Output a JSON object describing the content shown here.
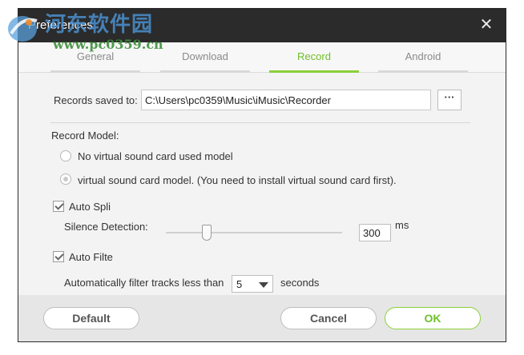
{
  "window": {
    "title": "Preferences",
    "close_glyph": "✕"
  },
  "tabs": [
    {
      "label": "General",
      "active": false
    },
    {
      "label": "Download",
      "active": false
    },
    {
      "label": "Record",
      "active": true
    },
    {
      "label": "Android",
      "active": false
    }
  ],
  "record": {
    "saved_to_label": "Records saved to:",
    "saved_to_value": "C:\\Users\\pc0359\\Music\\iMusic\\Recorder",
    "browse_label": "···",
    "model_label": "Record Model:",
    "model_options": [
      {
        "label": "No virtual sound card used model",
        "checked": false
      },
      {
        "label": "virtual sound card model. (You need to install virtual sound card first).",
        "checked": true
      }
    ],
    "auto_split": {
      "label": "Auto Spli",
      "checked": true
    },
    "silence_label": "Silence Detection:",
    "silence_slider_fraction": 0.23,
    "silence_value": "300",
    "silence_unit": "ms",
    "auto_filter": {
      "label": "Auto Filte",
      "checked": true
    },
    "filter_label": "Automatically filter tracks less than",
    "filter_value": "5",
    "filter_unit": "seconds"
  },
  "footer": {
    "default_label": "Default",
    "cancel_label": "Cancel",
    "ok_label": "OK"
  },
  "watermark": {
    "title": "河东软件园",
    "url": "www.pc0359.cn"
  },
  "colors": {
    "accent": "#8ad03a",
    "titlebar": "#2b2b2b"
  }
}
